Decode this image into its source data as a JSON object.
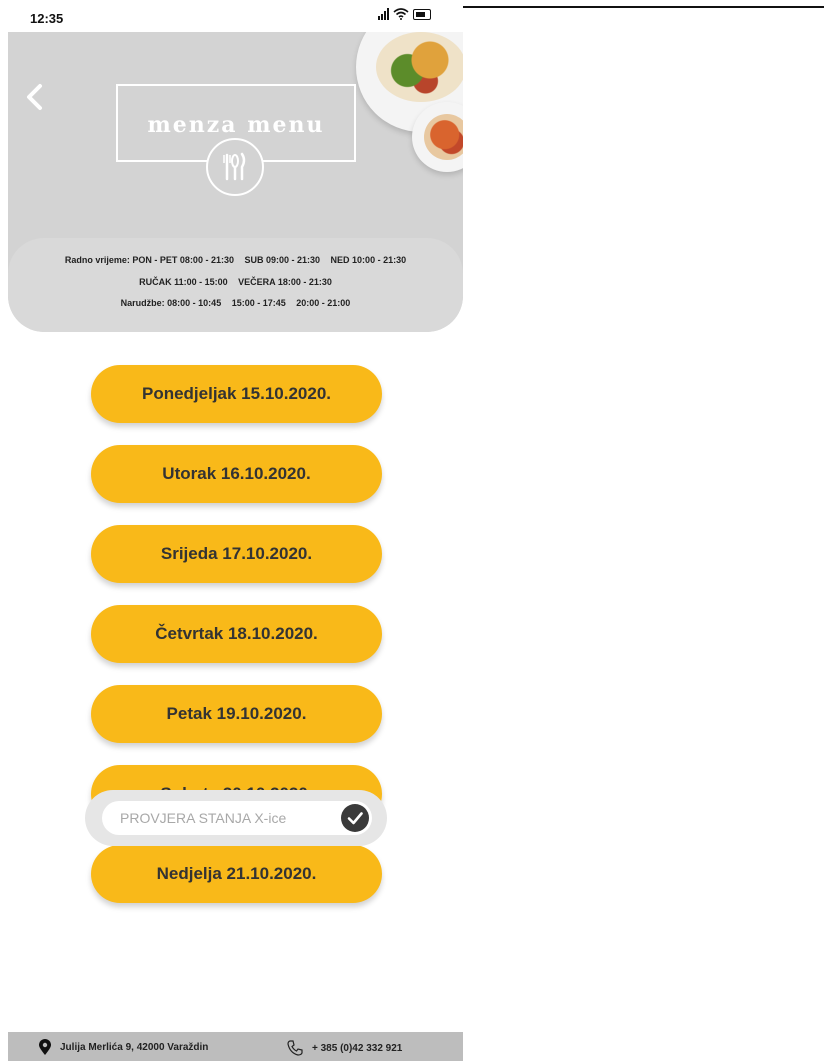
{
  "status_bar": {
    "time": "12:35"
  },
  "header": {
    "logo_text": "menza menu",
    "hours": {
      "line1": [
        "Radno vrijeme: PON - PET 08:00 - 21:30",
        "SUB 09:00 - 21:30",
        "NED 10:00 - 21:30"
      ],
      "line2": [
        "RUČAK 11:00 - 15:00",
        "VEČERA 18:00 - 21:30"
      ],
      "line3": [
        "Narudžbe: 08:00 - 10:45",
        "15:00 - 17:45",
        "20:00 - 21:00"
      ]
    }
  },
  "days": [
    {
      "label": "Ponedjeljak 15.10.2020."
    },
    {
      "label": "Utorak 16.10.2020."
    },
    {
      "label": "Srijeda 17.10.2020."
    },
    {
      "label": "Četvrtak 18.10.2020."
    },
    {
      "label": "Petak 19.10.2020."
    },
    {
      "label": "Subota 20.10.2020."
    },
    {
      "label": "Nedjelja 21.10.2020."
    }
  ],
  "balance_check": {
    "placeholder": "PROVJERA STANJA X-ice"
  },
  "footer": {
    "address": "Julija Merlića 9, 42000 Varaždin",
    "phone": "+ 385 (0)42 332 921"
  },
  "colors": {
    "accent": "#f9b919",
    "header_bg": "#d3d3d3",
    "footer_bg": "#bdbdbd"
  },
  "icons": {
    "back": "chevron-left-icon",
    "emblem": "cutlery-icon",
    "check": "checkmark-icon",
    "location": "map-pin-icon",
    "phone": "phone-icon"
  }
}
